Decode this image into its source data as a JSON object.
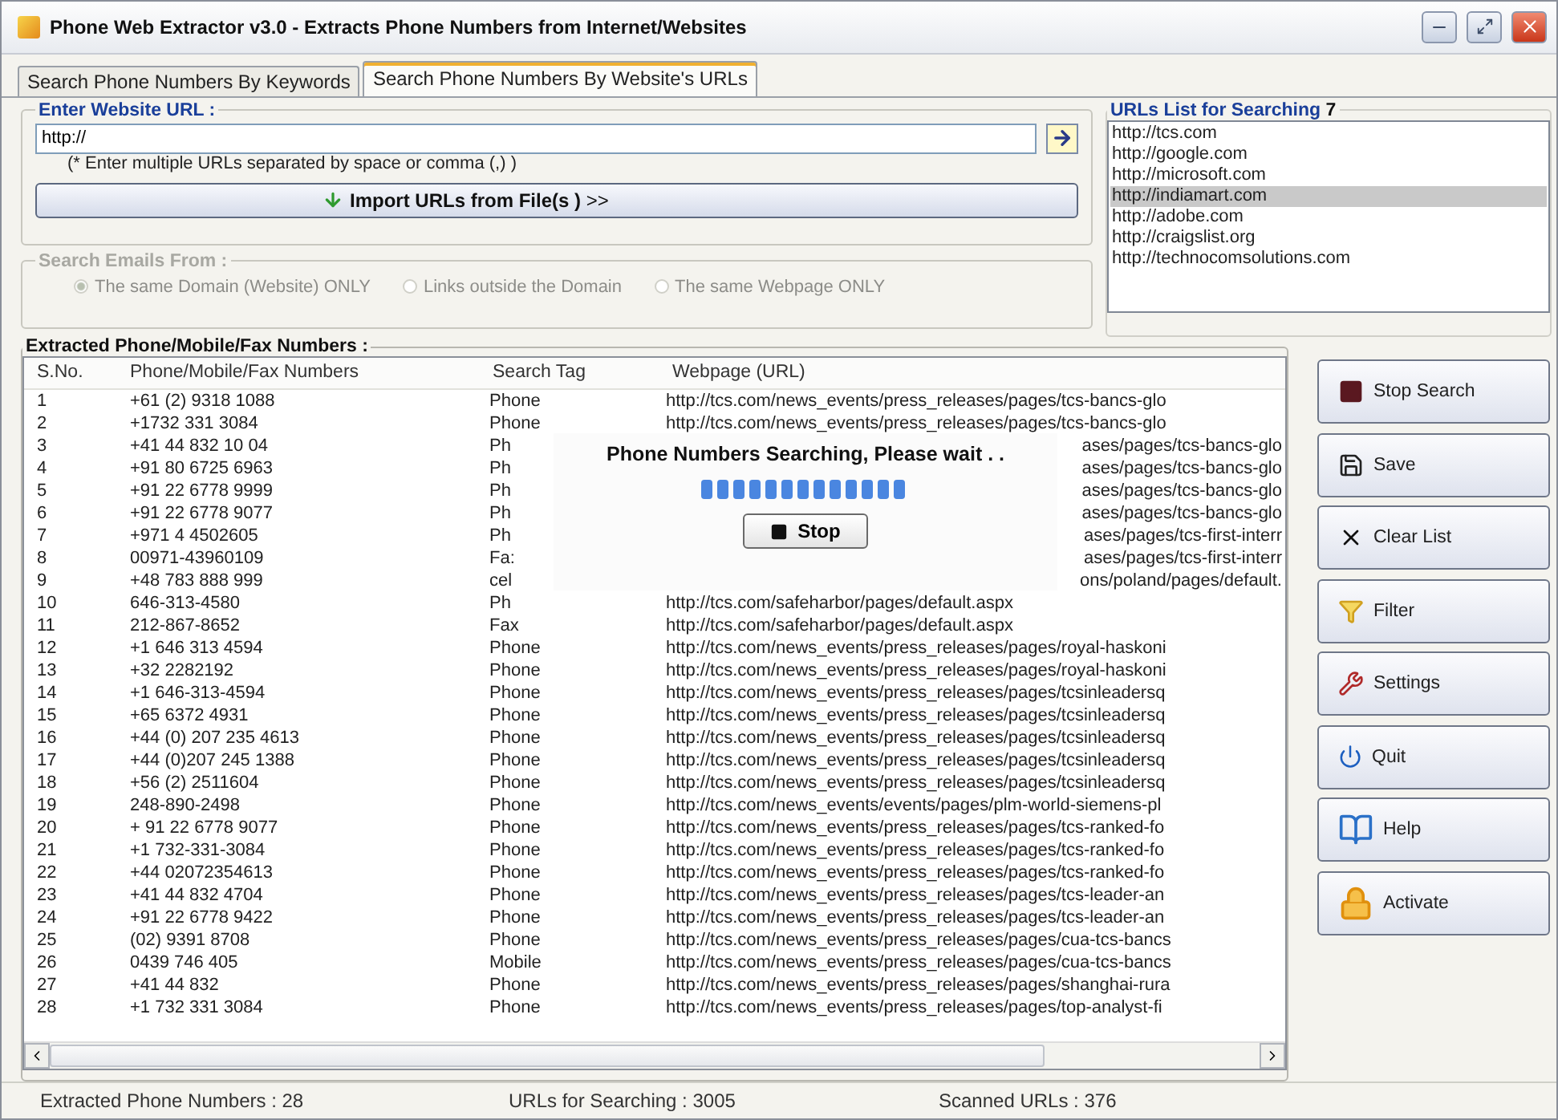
{
  "window": {
    "title": "Phone Web Extractor v3.0 - Extracts Phone Numbers from Internet/Websites"
  },
  "tabs": [
    {
      "label": "Search Phone Numbers By Keywords",
      "selected": false
    },
    {
      "label": "Search Phone Numbers By Website's URLs",
      "selected": true
    }
  ],
  "website_url": {
    "legend": "Enter Website URL :",
    "value": "http://",
    "hint": "(* Enter multiple URLs separated by space or comma (,) )",
    "import_button": "**Import URLs from File(s )** >>"
  },
  "search_emails": {
    "legend": "Search Emails From :",
    "disabled": true,
    "options": [
      {
        "label": "The same Domain (Website) ONLY",
        "selected": true
      },
      {
        "label": "Links outside the Domain",
        "selected": false
      },
      {
        "label": "The same Webpage ONLY",
        "selected": false
      }
    ]
  },
  "urls_list": {
    "legend": "URLs List for Searching",
    "count": "7",
    "items": [
      {
        "label": "http://tcs.com",
        "selected": false
      },
      {
        "label": "http://google.com",
        "selected": false
      },
      {
        "label": "http://microsoft.com",
        "selected": false
      },
      {
        "label": "http://indiamart.com",
        "selected": true
      },
      {
        "label": "http://adobe.com",
        "selected": false
      },
      {
        "label": "http://craigslist.org",
        "selected": false
      },
      {
        "label": "http://technocomsolutions.com",
        "selected": false
      }
    ]
  },
  "results": {
    "legend": "Extracted Phone/Mobile/Fax Numbers :",
    "columns": [
      "S.No.",
      "Phone/Mobile/Fax Numbers",
      "Search Tag",
      "Webpage (URL)"
    ],
    "rows": [
      {
        "sno": "1",
        "number": "+61 (2) 9318 1088",
        "tag": "Phone",
        "url": "http://tcs.com/news_events/press_releases/pages/tcs-bancs-glo",
        "covered": false
      },
      {
        "sno": "2",
        "number": "+1732 331 3084",
        "tag": "Phone",
        "url": "http://tcs.com/news_events/press_releases/pages/tcs-bancs-glo",
        "covered": false
      },
      {
        "sno": "3",
        "number": "+41 44 832 10 04",
        "tag": "Ph",
        "url": "ases/pages/tcs-bancs-glo",
        "covered": true
      },
      {
        "sno": "4",
        "number": "+91 80 6725 6963",
        "tag": "Ph",
        "url": "ases/pages/tcs-bancs-glo",
        "covered": true
      },
      {
        "sno": "5",
        "number": "+91 22 6778 9999",
        "tag": "Ph",
        "url": "ases/pages/tcs-bancs-glo",
        "covered": true
      },
      {
        "sno": "6",
        "number": "+91 22 6778 9077",
        "tag": "Ph",
        "url": "ases/pages/tcs-bancs-glo",
        "covered": true
      },
      {
        "sno": "7",
        "number": "+971 4 4502605",
        "tag": "Ph",
        "url": "ases/pages/tcs-first-interr",
        "covered": true
      },
      {
        "sno": "8",
        "number": "00971-43960109",
        "tag": "Fa:",
        "url": "ases/pages/tcs-first-interr",
        "covered": true
      },
      {
        "sno": "9",
        "number": "+48 783 888 999",
        "tag": "cel",
        "url": "ons/poland/pages/default.",
        "covered": true
      },
      {
        "sno": "10",
        "number": "646-313-4580",
        "tag": "Ph",
        "url": "http://tcs.com/safeharbor/pages/default.aspx",
        "covered": false
      },
      {
        "sno": "11",
        "number": "212-867-8652",
        "tag": "Fax",
        "url": "http://tcs.com/safeharbor/pages/default.aspx",
        "covered": false
      },
      {
        "sno": "12",
        "number": "+1 646 313 4594",
        "tag": "Phone",
        "url": "http://tcs.com/news_events/press_releases/pages/royal-haskoni",
        "covered": false
      },
      {
        "sno": "13",
        "number": "+32 2282192",
        "tag": "Phone",
        "url": "http://tcs.com/news_events/press_releases/pages/royal-haskoni",
        "covered": false
      },
      {
        "sno": "14",
        "number": "+1 646-313-4594",
        "tag": "Phone",
        "url": "http://tcs.com/news_events/press_releases/pages/tcsinleadersq",
        "covered": false
      },
      {
        "sno": "15",
        "number": "+65 6372 4931",
        "tag": "Phone",
        "url": "http://tcs.com/news_events/press_releases/pages/tcsinleadersq",
        "covered": false
      },
      {
        "sno": "16",
        "number": "+44 (0) 207 235 4613",
        "tag": "Phone",
        "url": "http://tcs.com/news_events/press_releases/pages/tcsinleadersq",
        "covered": false
      },
      {
        "sno": "17",
        "number": "+44 (0)207 245 1388",
        "tag": "Phone",
        "url": "http://tcs.com/news_events/press_releases/pages/tcsinleadersq",
        "covered": false
      },
      {
        "sno": "18",
        "number": "+56 (2) 2511604",
        "tag": "Phone",
        "url": "http://tcs.com/news_events/press_releases/pages/tcsinleadersq",
        "covered": false
      },
      {
        "sno": "19",
        "number": "248-890-2498",
        "tag": "Phone",
        "url": "http://tcs.com/news_events/events/pages/plm-world-siemens-pl",
        "covered": false
      },
      {
        "sno": "20",
        "number": "+ 91 22 6778 9077",
        "tag": "Phone",
        "url": "http://tcs.com/news_events/press_releases/pages/tcs-ranked-fo",
        "covered": false
      },
      {
        "sno": "21",
        "number": "+1 732-331-3084",
        "tag": "Phone",
        "url": "http://tcs.com/news_events/press_releases/pages/tcs-ranked-fo",
        "covered": false
      },
      {
        "sno": "22",
        "number": "+44 02072354613",
        "tag": "Phone",
        "url": "http://tcs.com/news_events/press_releases/pages/tcs-ranked-fo",
        "covered": false
      },
      {
        "sno": "23",
        "number": "+41 44 832 4704",
        "tag": "Phone",
        "url": "http://tcs.com/news_events/press_releases/pages/tcs-leader-an",
        "covered": false
      },
      {
        "sno": "24",
        "number": "+91 22 6778 9422",
        "tag": "Phone",
        "url": "http://tcs.com/news_events/press_releases/pages/tcs-leader-an",
        "covered": false
      },
      {
        "sno": "25",
        "number": "(02) 9391 8708",
        "tag": "Phone",
        "url": "http://tcs.com/news_events/press_releases/pages/cua-tcs-bancs",
        "covered": false
      },
      {
        "sno": "26",
        "number": "0439 746 405",
        "tag": "Mobile",
        "url": "http://tcs.com/news_events/press_releases/pages/cua-tcs-bancs",
        "covered": false
      },
      {
        "sno": "27",
        "number": "+41 44 832",
        "tag": "Phone",
        "url": "http://tcs.com/news_events/press_releases/pages/shanghai-rura",
        "covered": false
      },
      {
        "sno": "28",
        "number": "+1 732 331 3084",
        "tag": "Phone",
        "url": "http://tcs.com/news_events/press_releases/pages/top-analyst-fi",
        "covered": false
      }
    ]
  },
  "progress_dialog": {
    "message": "Phone Numbers Searching, Please wait . .",
    "stop_button": "Stop"
  },
  "actions": [
    {
      "label": "Stop Search",
      "kind": "stop"
    },
    {
      "label": "Save",
      "kind": "save"
    },
    {
      "label": "Clear List",
      "kind": "clear"
    },
    {
      "label": "Filter",
      "kind": "filter"
    },
    {
      "label": "Settings",
      "kind": "settings"
    },
    {
      "label": "Quit",
      "kind": "quit"
    },
    {
      "label": "Help",
      "kind": "help"
    },
    {
      "label": "Activate",
      "kind": "activate"
    }
  ],
  "status_bar": [
    "Extracted Phone Numbers :  28",
    "URLs for Searching :  3005",
    "Scanned URLs :  376"
  ]
}
